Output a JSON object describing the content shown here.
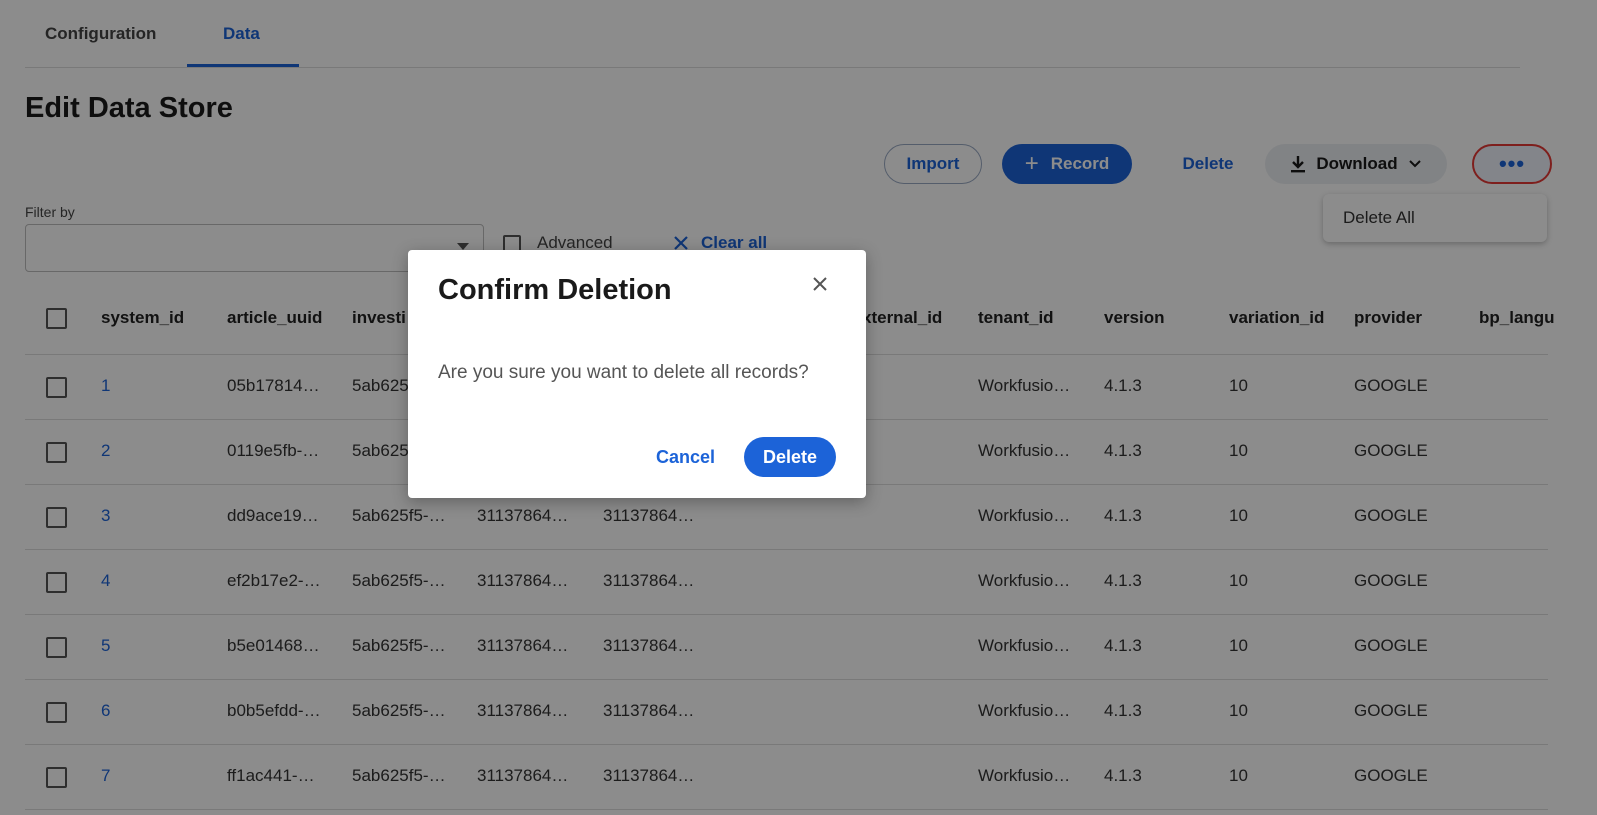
{
  "tabs": [
    {
      "label": "Configuration"
    },
    {
      "label": "Data"
    }
  ],
  "page": {
    "title": "Edit Data Store"
  },
  "toolbar": {
    "import_label": "Import",
    "record_label": "Record",
    "delete_label": "Delete",
    "download_label": "Download",
    "more_label": "•••"
  },
  "more_menu": {
    "items": [
      {
        "label": "Delete All"
      }
    ]
  },
  "filter": {
    "label": "Filter by",
    "advanced_label": "Advanced",
    "clear_all_label": "Clear all"
  },
  "table": {
    "columns": [
      "system_id",
      "article_uuid",
      "investi",
      "xternal_id",
      "tenant_id",
      "version",
      "variation_id",
      "provider",
      "bp_langu"
    ],
    "rows": [
      {
        "id": "1",
        "article_uuid": "05b17814…",
        "investigation": "5ab625",
        "c4": "",
        "c5": "",
        "tenant": "Workfusio…",
        "version": "4.1.3",
        "variation": "10",
        "provider": "GOOGLE"
      },
      {
        "id": "2",
        "article_uuid": "0119e5fb-…",
        "investigation": "5ab625",
        "c4": "",
        "c5": "",
        "tenant": "Workfusio…",
        "version": "4.1.3",
        "variation": "10",
        "provider": "GOOGLE"
      },
      {
        "id": "3",
        "article_uuid": "dd9ace19…",
        "investigation": "5ab625f5-…",
        "c4": "31137864…",
        "c5": "31137864…",
        "tenant": "Workfusio…",
        "version": "4.1.3",
        "variation": "10",
        "provider": "GOOGLE"
      },
      {
        "id": "4",
        "article_uuid": "ef2b17e2-…",
        "investigation": "5ab625f5-…",
        "c4": "31137864…",
        "c5": "31137864…",
        "tenant": "Workfusio…",
        "version": "4.1.3",
        "variation": "10",
        "provider": "GOOGLE"
      },
      {
        "id": "5",
        "article_uuid": "b5e01468…",
        "investigation": "5ab625f5-…",
        "c4": "31137864…",
        "c5": "31137864…",
        "tenant": "Workfusio…",
        "version": "4.1.3",
        "variation": "10",
        "provider": "GOOGLE"
      },
      {
        "id": "6",
        "article_uuid": "b0b5efdd-…",
        "investigation": "5ab625f5-…",
        "c4": "31137864…",
        "c5": "31137864…",
        "tenant": "Workfusio…",
        "version": "4.1.3",
        "variation": "10",
        "provider": "GOOGLE"
      },
      {
        "id": "7",
        "article_uuid": "ff1ac441-…",
        "investigation": "5ab625f5-…",
        "c4": "31137864…",
        "c5": "31137864…",
        "tenant": "Workfusio…",
        "version": "4.1.3",
        "variation": "10",
        "provider": "GOOGLE"
      }
    ]
  },
  "dialog": {
    "title": "Confirm Deletion",
    "message": "Are you sure you want to delete all records?",
    "cancel_label": "Cancel",
    "delete_label": "Delete"
  },
  "colors": {
    "accent": "#1c63d8",
    "highlight": "#e53935"
  }
}
